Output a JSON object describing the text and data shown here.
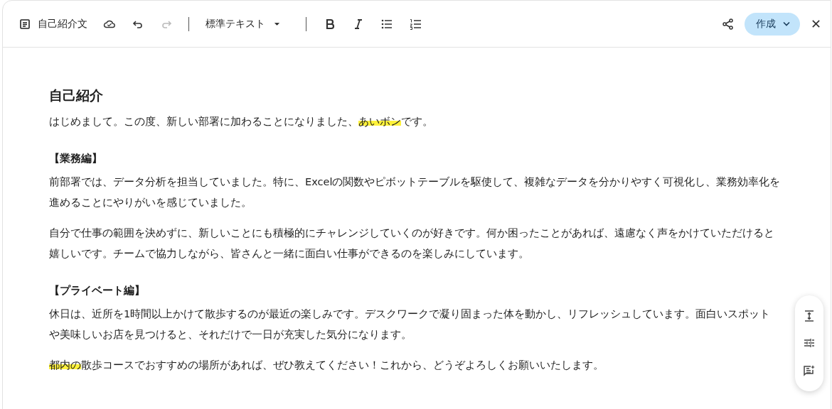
{
  "toolbar": {
    "doc_title": "自己紹介文",
    "style_dropdown": "標準テキスト",
    "create_button": "作成"
  },
  "document": {
    "heading": "自己紹介",
    "blocks": [
      {
        "kind": "paragraph",
        "segments": [
          {
            "text": "はじめまして。この度、新しい部署に加わることになりました、",
            "highlight": false
          },
          {
            "text": "あいボン",
            "highlight": true
          },
          {
            "text": "です。",
            "highlight": false
          }
        ]
      },
      {
        "kind": "subheading",
        "segments": [
          {
            "text": "【業務編】",
            "highlight": false
          }
        ]
      },
      {
        "kind": "paragraph",
        "segments": [
          {
            "text": "前部署では、データ分析を担当していました。特に、Excelの関数やピボットテーブルを駆使して、複雑なデータを分かりやすく可視化し、業務効率化を進めることにやりがいを感じていました。",
            "highlight": false
          }
        ]
      },
      {
        "kind": "paragraph",
        "segments": [
          {
            "text": "自分で仕事の範囲を決めずに、新しいことにも積極的にチャレンジしていくのが好きです。何か困ったことがあれば、遠慮なく声をかけていただけると嬉しいです。チームで協力しながら、皆さんと一緒に面白い仕事ができるのを楽しみにしています。",
            "highlight": false
          }
        ]
      },
      {
        "kind": "subheading",
        "segments": [
          {
            "text": "【プライベート編】",
            "highlight": false
          }
        ]
      },
      {
        "kind": "paragraph",
        "segments": [
          {
            "text": "休日は、近所を1時間以上かけて散歩するのが最近の楽しみです。デスクワークで凝り固まった体を動かし、リフレッシュしています。面白いスポットや美味しいお店を見つけると、それだけで一日が充実した気分になります。",
            "highlight": false
          }
        ]
      },
      {
        "kind": "paragraph",
        "segments": [
          {
            "text": "都内の",
            "highlight": true
          },
          {
            "text": "散歩コースでおすすめの場所があれば、ぜひ教えてください！これから、どうぞよろしくお願いいたします。",
            "highlight": false
          }
        ]
      }
    ]
  }
}
